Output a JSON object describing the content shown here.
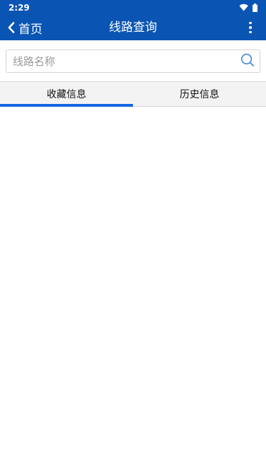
{
  "status_bar": {
    "time": "2:29",
    "icons": [
      "wifi-icon",
      "battery-icon"
    ]
  },
  "app_bar": {
    "back_label": "首页",
    "title": "线路查询",
    "back_icon": "chevron-left-icon",
    "menu_icon": "more-vert-icon"
  },
  "search": {
    "placeholder": "线路名称",
    "value": "",
    "icon": "search-icon"
  },
  "tabs": [
    {
      "label": "收藏信息",
      "selected": true
    },
    {
      "label": "历史信息",
      "selected": false
    }
  ],
  "colors": {
    "primary": "#0a55b4",
    "tab_indicator": "#1565e0",
    "tab_background": "#f3f3f3",
    "search_icon": "#3b82d6"
  }
}
